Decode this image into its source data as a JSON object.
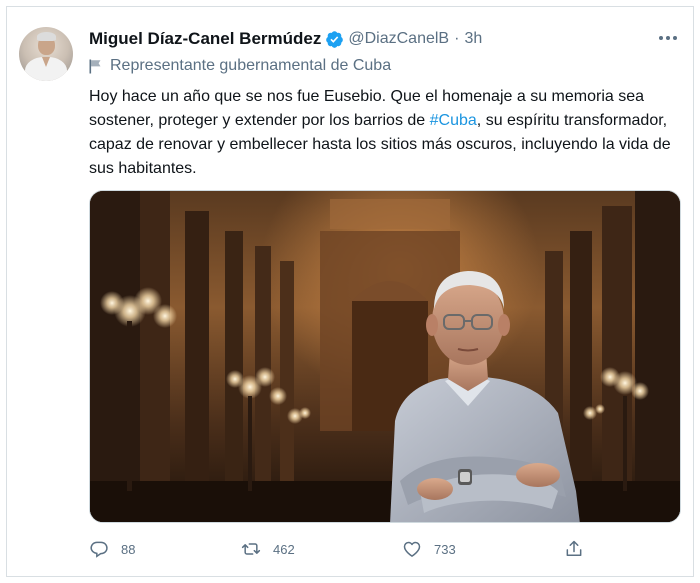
{
  "author": {
    "name": "Miguel Díaz-Canel Bermúdez",
    "handle": "@DiazCanelB",
    "separator": "·",
    "time": "3h",
    "label": "Representante gubernamental de Cuba"
  },
  "tweet": {
    "text_before_hashtag": "Hoy hace un año que se nos fue Eusebio. Que el homenaje a su memoria sea sostener, proteger y extender por los barrios de ",
    "hashtag": "#Cuba",
    "text_after_hashtag": ", su espíritu transformador, capaz de renovar y embellecer hasta los sitios más oscuros, incluyendo la vida de sus habitantes."
  },
  "actions": {
    "replies": "88",
    "retweets": "462",
    "likes": "733"
  },
  "colors": {
    "accent": "#1b95e0",
    "muted": "#5b7083",
    "verified": "#1da1f2"
  },
  "icons": [
    "verified-badge-icon",
    "more-options-icon",
    "government-flag-icon",
    "reply-icon",
    "retweet-icon",
    "like-icon",
    "share-icon"
  ]
}
